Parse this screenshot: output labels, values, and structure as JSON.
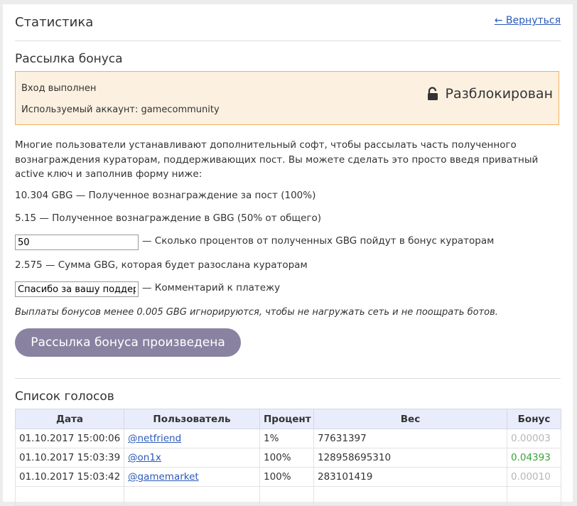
{
  "header": {
    "title": "Статистика",
    "back_link": "← Вернуться"
  },
  "section": {
    "title": "Рассылка бонуса",
    "status_line1": "Вход выполнен",
    "status_line2": "Используемый аккаунт: gamecommunity",
    "lock_status": "Разблокирован",
    "lock_icon": "unlocked-padlock-icon"
  },
  "description": "Многие пользователи устанавливают дополнительный софт, чтобы рассылать часть полученного вознаграждения кураторам, поддерживающих пост. Вы можете сделать это просто введя приватный active ключ и заполнив форму ниже:",
  "lines": {
    "reward": "10.304 GBG — Полученное вознаграждение за пост (100%)",
    "reward_gbg": "5.15 — Полученное вознаграждение в GBG (50% от общего)",
    "sum": "2.575 — Сумма GBG, которая будет разослана кураторам"
  },
  "form": {
    "percent_value": "50",
    "percent_label": "— Сколько процентов от полученных GBG пойдут в бонус кураторам",
    "comment_value": "Спасибо за вашу поддержку",
    "comment_label": "— Комментарий к платежу"
  },
  "note": "Выплаты бонусов менее 0.005 GBG игнорируются, чтобы не нагружать сеть и не поощрать ботов.",
  "button_label": "Рассылка бонуса произведена",
  "votes": {
    "title": "Список голосов",
    "columns": [
      "Дата",
      "Пользователь",
      "Процент",
      "Вес",
      "Бонус"
    ],
    "rows": [
      {
        "date": "01.10.2017 15:00:06",
        "user": "@netfriend",
        "percent": "1%",
        "weight": "77631397",
        "bonus": "0.00003"
      },
      {
        "date": "01.10.2017 15:03:39",
        "user": "@on1x",
        "percent": "100%",
        "weight": "128958695310",
        "bonus": "0.04393"
      },
      {
        "date": "01.10.2017 15:03:42",
        "user": "@gamemarket",
        "percent": "100%",
        "weight": "283101419",
        "bonus": "0.00010"
      }
    ]
  },
  "colors": {
    "status_bg": "#fcf1e1",
    "status_border": "#f0b25c",
    "button_bg": "#8a82a1",
    "link": "#2a5ab8",
    "bonus_green": "#3aa43a",
    "bonus_gray": "#b7b7b7",
    "table_header_bg": "#e8ecfb"
  }
}
